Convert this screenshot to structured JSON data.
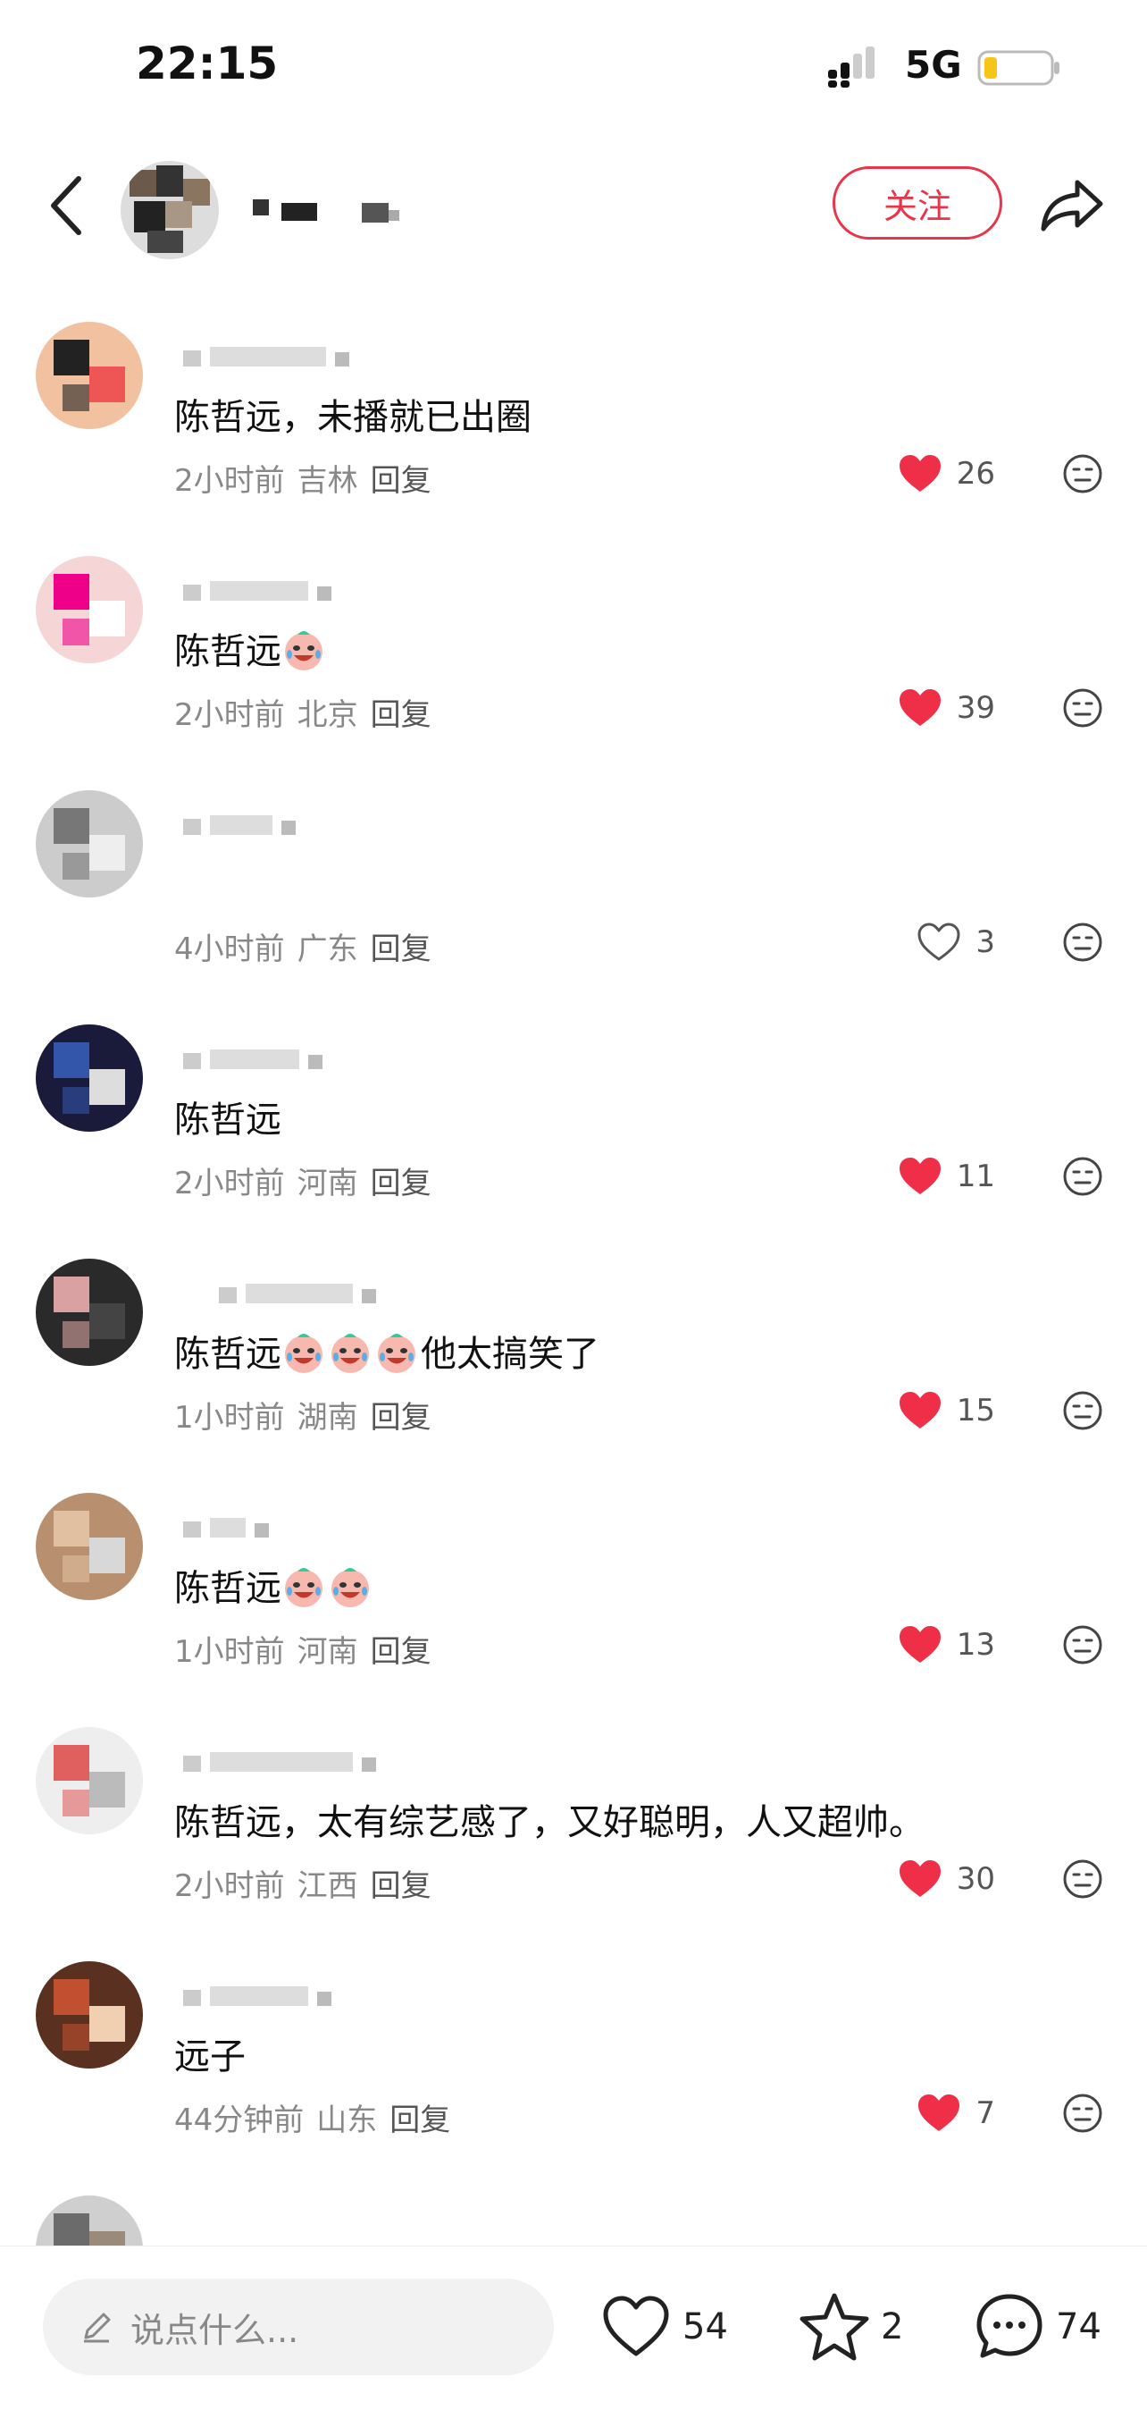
{
  "status_bar": {
    "time": "22:15",
    "network": "5G",
    "battery_color": "#f5c518"
  },
  "header": {
    "follow_label": "关注",
    "accent": "#e8354a"
  },
  "comments": [
    {
      "text": "陈哲远，未播就已出圈",
      "emoji_after": 0,
      "suffix": "",
      "time": "2小时前",
      "location": "吉林",
      "reply": "回复",
      "likes": "26",
      "liked": true
    },
    {
      "text": "陈哲远",
      "emoji_after": 1,
      "suffix": "",
      "time": "2小时前",
      "location": "北京",
      "reply": "回复",
      "likes": "39",
      "liked": true
    },
    {
      "text": "",
      "emoji_after": 0,
      "suffix": "",
      "time": "4小时前",
      "location": "广东",
      "reply": "回复",
      "likes": "3",
      "liked": false
    },
    {
      "text": "陈哲远",
      "emoji_after": 0,
      "suffix": "",
      "time": "2小时前",
      "location": "河南",
      "reply": "回复",
      "likes": "11",
      "liked": true
    },
    {
      "text": "陈哲远",
      "emoji_after": 3,
      "suffix": "他太搞笑了",
      "time": "1小时前",
      "location": "湖南",
      "reply": "回复",
      "likes": "15",
      "liked": true
    },
    {
      "text": "陈哲远",
      "emoji_after": 2,
      "suffix": "",
      "time": "1小时前",
      "location": "河南",
      "reply": "回复",
      "likes": "13",
      "liked": true
    },
    {
      "text": "陈哲远，太有综艺感了，又好聪明，人又超帅。",
      "emoji_after": 0,
      "suffix": "",
      "time": "2小时前",
      "location": "江西",
      "reply": "回复",
      "likes": "30",
      "liked": true
    },
    {
      "text": "远子",
      "emoji_after": 0,
      "suffix": "",
      "time": "44分钟前",
      "location": "山东",
      "reply": "回复",
      "likes": "7",
      "liked": true
    }
  ],
  "bottom_bar": {
    "input_placeholder": "说点什么...",
    "likes": "54",
    "favorites": "2",
    "comments": "74"
  },
  "icons": [
    "back-icon",
    "share-icon",
    "heart-icon",
    "dislike-icon",
    "pencil-icon",
    "star-icon",
    "chat-icon"
  ]
}
